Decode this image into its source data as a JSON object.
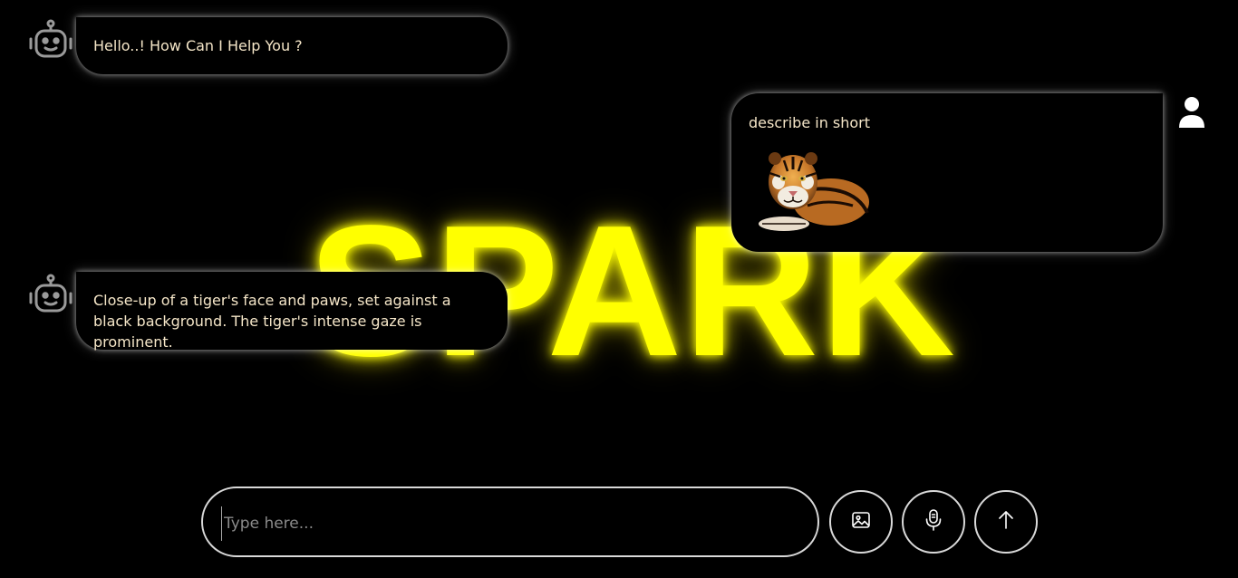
{
  "app": {
    "brand": "SPARK",
    "colors": {
      "background": "#000000",
      "brand": "#ffff00",
      "message_text": "#f5e6c8",
      "border": "#d9d9d9"
    }
  },
  "chat": {
    "messages": [
      {
        "role": "bot",
        "avatar_icon": "robot-icon",
        "text": "Hello..! How Can I Help You ?"
      },
      {
        "role": "user",
        "avatar_icon": "user-icon",
        "text": "describe in short",
        "attachment": "tiger-image"
      },
      {
        "role": "bot",
        "avatar_icon": "robot-icon",
        "text": "Close-up of a tiger's face and paws, set against a black background. The tiger's intense gaze is prominent."
      }
    ]
  },
  "composer": {
    "placeholder": "Type here...",
    "value": "",
    "buttons": [
      {
        "name": "image-upload",
        "icon": "image-icon"
      },
      {
        "name": "voice-input",
        "icon": "microphone-icon"
      },
      {
        "name": "send",
        "icon": "arrow-up-icon"
      }
    ]
  }
}
